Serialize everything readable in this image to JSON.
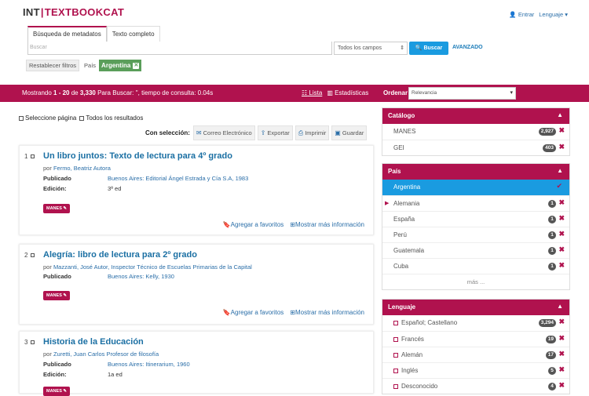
{
  "brand": {
    "part1": "INT",
    "part2": "TEXTBOOKCAT"
  },
  "toplinks": {
    "login": "Entrar",
    "language": "Lenguaje"
  },
  "tabs": [
    {
      "label": "Búsqueda de metadatos"
    },
    {
      "label": "Texto completo"
    }
  ],
  "search": {
    "placeholder": "Buscar",
    "field_selected": "Todos los campos",
    "button": "Buscar",
    "advanced": "AVANZADO"
  },
  "filters": {
    "reset": "Restablecer filtros",
    "label": "País",
    "chip": "Argentina"
  },
  "results_bar": {
    "prefix": "Mostrando ",
    "range": "1 - 20",
    "of": " de ",
    "total": "3,330",
    "suffix": " Para Buscar: '', tiempo de consulta: 0.04s",
    "view_list": "Lista",
    "view_stats": "Estadísticas",
    "order_label": "Ordenar",
    "order_selected": "Relevancia"
  },
  "select": {
    "page": "Seleccione página",
    "all": "Todos los resultados"
  },
  "actions": {
    "label": "Con selección:",
    "email": "Correo Electrónico",
    "export": "Exportar",
    "print": "Imprimir",
    "save": "Guardar"
  },
  "results": [
    {
      "num": "1",
      "title": "Un libro juntos: Texto de lectura para 4º grado",
      "by": "por",
      "author": "Fermo, Beatriz Autora",
      "rows": [
        {
          "k": "Publicado",
          "v": "Buenos Aires: Editorial Ángel Estrada y Cía S.A, 1983",
          "link": true
        },
        {
          "k": "Edición:",
          "v": "3ª ed",
          "link": false
        }
      ],
      "badge": "MANES ✎",
      "fav": "Agregar a favoritos",
      "more": "Mostrar más información"
    },
    {
      "num": "2",
      "title": "Alegría: libro de lectura para 2º grado",
      "by": "por",
      "author": "Mazzanti, José Autor, Inspector Técnico de Escuelas Primarias de la Capital",
      "rows": [
        {
          "k": "Publicado",
          "v": "Buenos Aires: Kelly, 1930",
          "link": true
        }
      ],
      "badge": "MANES ✎",
      "fav": "Agregar a favoritos",
      "more": "Mostrar más información"
    },
    {
      "num": "3",
      "title": "Historia de la Educación",
      "by": "por",
      "author": "Zuretti, Juan Carlos Profesor de filosofía",
      "rows": [
        {
          "k": "Publicado",
          "v": "Buenos Aires: Itinerarium, 1960",
          "link": true
        },
        {
          "k": "Edición:",
          "v": "1a ed",
          "link": false
        }
      ],
      "badge": "MANES ✎",
      "fav": "",
      "more": ""
    }
  ],
  "facets": {
    "catalog": {
      "title": "Catálogo",
      "items": [
        {
          "label": "MANES",
          "count": "2,927"
        },
        {
          "label": "GEI",
          "count": "403"
        }
      ]
    },
    "country": {
      "title": "País",
      "items": [
        {
          "label": "Argentina",
          "count": ""
        },
        {
          "label": "Alemania",
          "count": "1"
        },
        {
          "label": "España",
          "count": "1"
        },
        {
          "label": "Perú",
          "count": "1"
        },
        {
          "label": "Guatemala",
          "count": "1"
        },
        {
          "label": "Cuba",
          "count": "1"
        }
      ],
      "more": "más ..."
    },
    "language": {
      "title": "Lenguaje",
      "items": [
        {
          "label": "Español; Castellano",
          "count": "3,294"
        },
        {
          "label": "Francés",
          "count": "19"
        },
        {
          "label": "Alemán",
          "count": "17"
        },
        {
          "label": "Inglés",
          "count": "5"
        },
        {
          "label": "Desconocido",
          "count": "4"
        }
      ]
    }
  },
  "colors": {
    "brand": "#b0124e",
    "accent": "#1a9be0",
    "link": "#1a6fa3",
    "chip": "#5a9e5a"
  }
}
